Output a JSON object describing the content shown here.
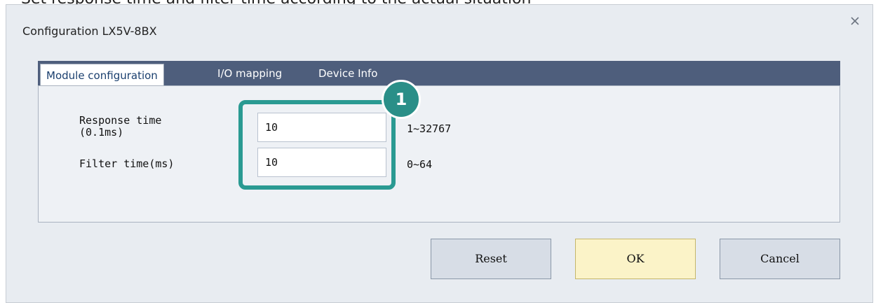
{
  "document_fragment": {
    "text": "Set response time and filter time according to the actual situation"
  },
  "dialog": {
    "title": "Configuration LX5V-8BX",
    "close_glyph": "×"
  },
  "tabs": [
    {
      "label": "Module configuration",
      "active": true
    },
    {
      "label": "I/O mapping",
      "active": false
    },
    {
      "label": "Device Info",
      "active": false
    }
  ],
  "fields": {
    "response_time": {
      "label_line1": "Response time",
      "label_line2": "(0.1ms)",
      "value": "10",
      "range": "1~32767"
    },
    "filter_time": {
      "label": "Filter time(ms)",
      "value": "10",
      "range": "0~64"
    }
  },
  "annotation": {
    "step": "1",
    "color": "#2a9a92"
  },
  "buttons": {
    "reset": "Reset",
    "ok": "OK",
    "cancel": "Cancel"
  },
  "colors": {
    "tab_bar": "#4e5e7c",
    "ok_button": "#fbf3c8",
    "dialog_bg": "#e8ecf1"
  }
}
